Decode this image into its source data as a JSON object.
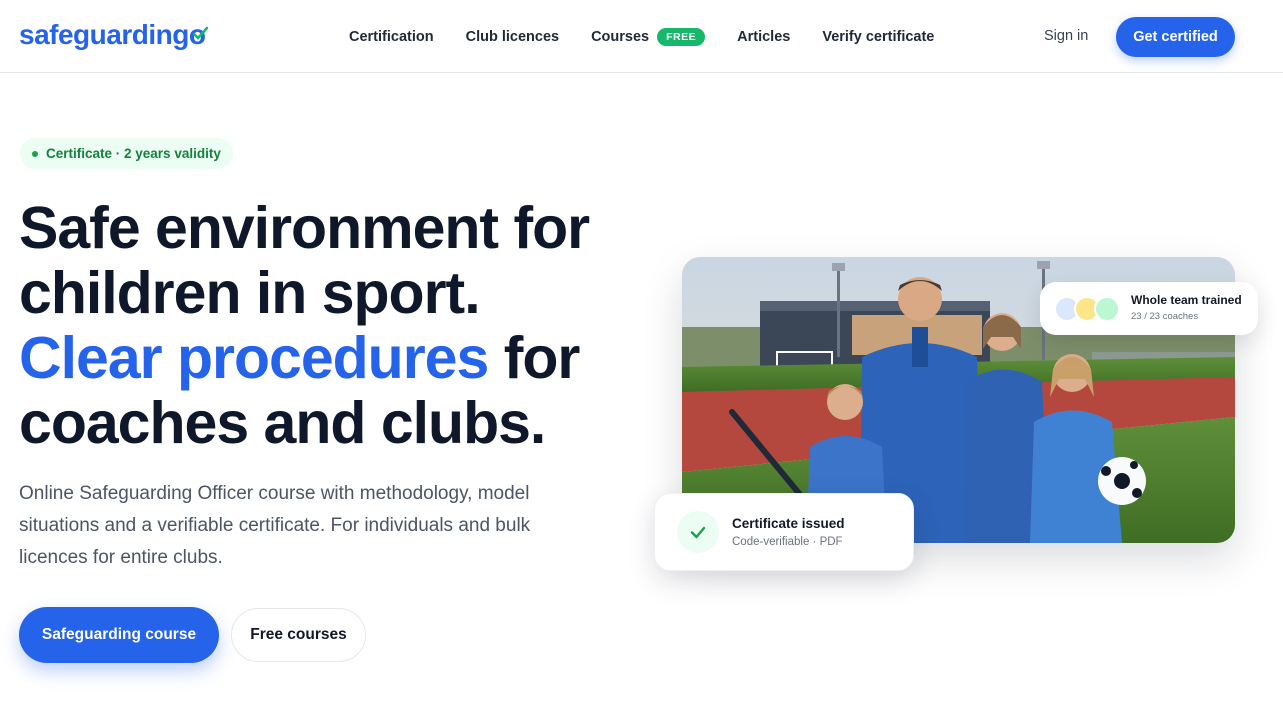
{
  "header": {
    "logo_text": "safeguardingo",
    "nav": [
      {
        "label": "Certification"
      },
      {
        "label": "Club licences"
      },
      {
        "label": "Courses",
        "badge": "FREE"
      },
      {
        "label": "Articles"
      },
      {
        "label": "Verify certificate"
      }
    ],
    "signin_label": "Sign in",
    "cta_label": "Get certified"
  },
  "hero": {
    "pill": "Certificate · 2 years validity",
    "headline_line1": "Safe environment for",
    "headline_line2": "children in sport.",
    "headline_accent": "Clear procedures",
    "headline_line3_rest": " for",
    "headline_line4": "coaches and clubs.",
    "lead": "Online Safeguarding Officer course with methodology, model situations and a verifiable certificate. For individuals and bulk licences for entire clubs.",
    "primary_button": "Safeguarding course",
    "secondary_button": "Free courses"
  },
  "team_card": {
    "title": "Whole team trained",
    "subtitle": "23 / 23 coaches"
  },
  "cert_card": {
    "title": "Certificate issued",
    "subtitle": "Code-verifiable · PDF"
  },
  "colors": {
    "brand": "#2563eb",
    "success": "#16b869",
    "text_dark": "#0f172a"
  },
  "icons": {
    "logo_check": "check-icon",
    "cert_check": "check-icon"
  }
}
